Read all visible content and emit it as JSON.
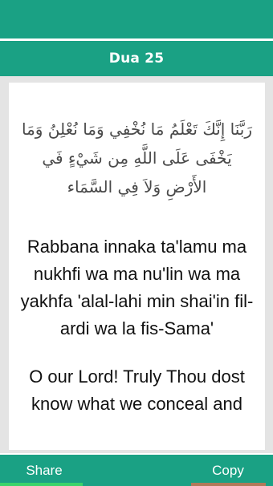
{
  "header": {
    "title": "Dua 25"
  },
  "dua": {
    "arabic": "رَبَّنَا إِنَّكَ تَعْلَمُ مَا نُخْفِي وَمَا نُعْلِنُ وَمَا يَخْفَى عَلَى اللَّهِ مِن شَيْءٍ فَي الأَرْضِ وَلاَ فِي السَّمَاء",
    "transliteration": "Rabbana innaka ta'lamu ma nukhfi wa ma nu'lin wa ma yakhfa 'alal-lahi min shai'in fil-ardi wa la fis-Sama'",
    "translation_line1": "O our Lord! Truly Thou dost",
    "translation_line2": "know what we conceal and"
  },
  "footer": {
    "share_label": "Share",
    "copy_label": "Copy"
  },
  "colors": {
    "primary": "#1aa184",
    "background": "#e4e4e4",
    "share_accent": "#3ad36a",
    "copy_accent": "#b07a5a"
  }
}
